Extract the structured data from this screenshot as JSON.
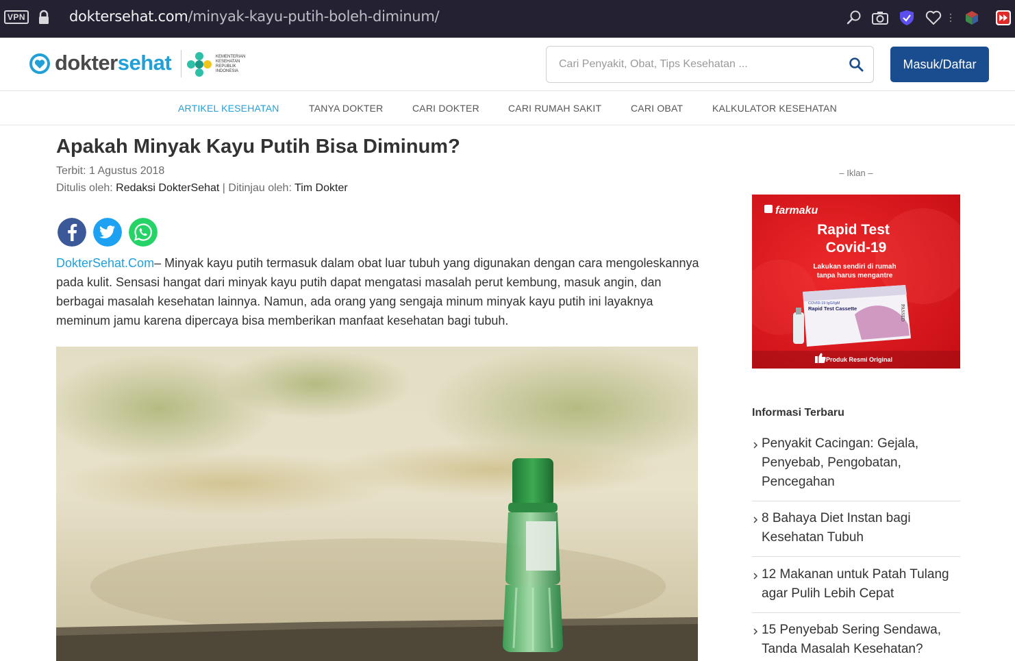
{
  "browser": {
    "vpn_label": "VPN",
    "url_domain": "doktersehat.com",
    "url_path": "/minyak-kayu-putih-boleh-diminum/"
  },
  "header": {
    "logo_part1": "dokter",
    "logo_part2": "sehat",
    "partner_text": "KEMENTERIAN KESEHATAN REPUBLIK INDONESIA",
    "search_placeholder": "Cari Penyakit, Obat, Tips Kesehatan ...",
    "login_label": "Masuk/Daftar",
    "brand_color": "#21a0d8",
    "button_color": "#1a4d8f"
  },
  "nav": {
    "items": [
      {
        "label": "ARTIKEL KESEHATAN",
        "active": true
      },
      {
        "label": "TANYA DOKTER"
      },
      {
        "label": "CARI DOKTER"
      },
      {
        "label": "CARI RUMAH SAKIT"
      },
      {
        "label": "CARI OBAT"
      },
      {
        "label": "KALKULATOR KESEHATAN"
      }
    ]
  },
  "article": {
    "title": "Apakah Minyak Kayu Putih Bisa Diminum?",
    "published": "Terbit: 1 Agustus 2018",
    "written_label": "Ditulis oleh:",
    "author": "Redaksi DokterSehat",
    "separator": " | ",
    "reviewed_label": "Ditinjau oleh:",
    "reviewer": "Tim Dokter",
    "share_icons": [
      "facebook-icon",
      "twitter-icon",
      "whatsapp-icon"
    ],
    "lead_source": "DokterSehat.Com",
    "lead_text": "– Minyak kayu putih termasuk dalam obat luar tubuh yang digunakan dengan cara mengoleskannya pada kulit. Sensasi hangat dari minyak kayu putih dapat mengatasi masalah perut kembung, masuk angin, dan berbagai masalah kesehatan lainnya. Namun, ada orang yang sengaja minum minyak kayu putih ini layaknya meminum jamu karena dipercaya bisa memberikan manfaat kesehatan bagi tubuh."
  },
  "sidebar": {
    "ad_label": "– Iklan –",
    "ad": {
      "brand": "farmaku",
      "headline_1": "Rapid Test",
      "headline_2": "Covid-19",
      "sub_1": "Lakukan sendiri di rumah",
      "sub_2": "tanpa harus mengantre",
      "product_line_1": "COVID-19 IgG/IgM",
      "product_line_2": "Rapid Test Cassette",
      "stamp": "PASSED",
      "footer": "Produk Resmi Original"
    },
    "latest_heading": "Informasi Terbaru",
    "latest": [
      "Penyakit Cacingan: Gejala, Penyebab, Pengobatan, Pencegahan",
      "8 Bahaya Diet Instan bagi Kesehatan Tubuh",
      "12 Makanan untuk Patah Tulang agar Pulih Lebih Cepat",
      "15 Penyebab Sering Sendawa, Tanda Masalah Kesehatan?"
    ]
  }
}
